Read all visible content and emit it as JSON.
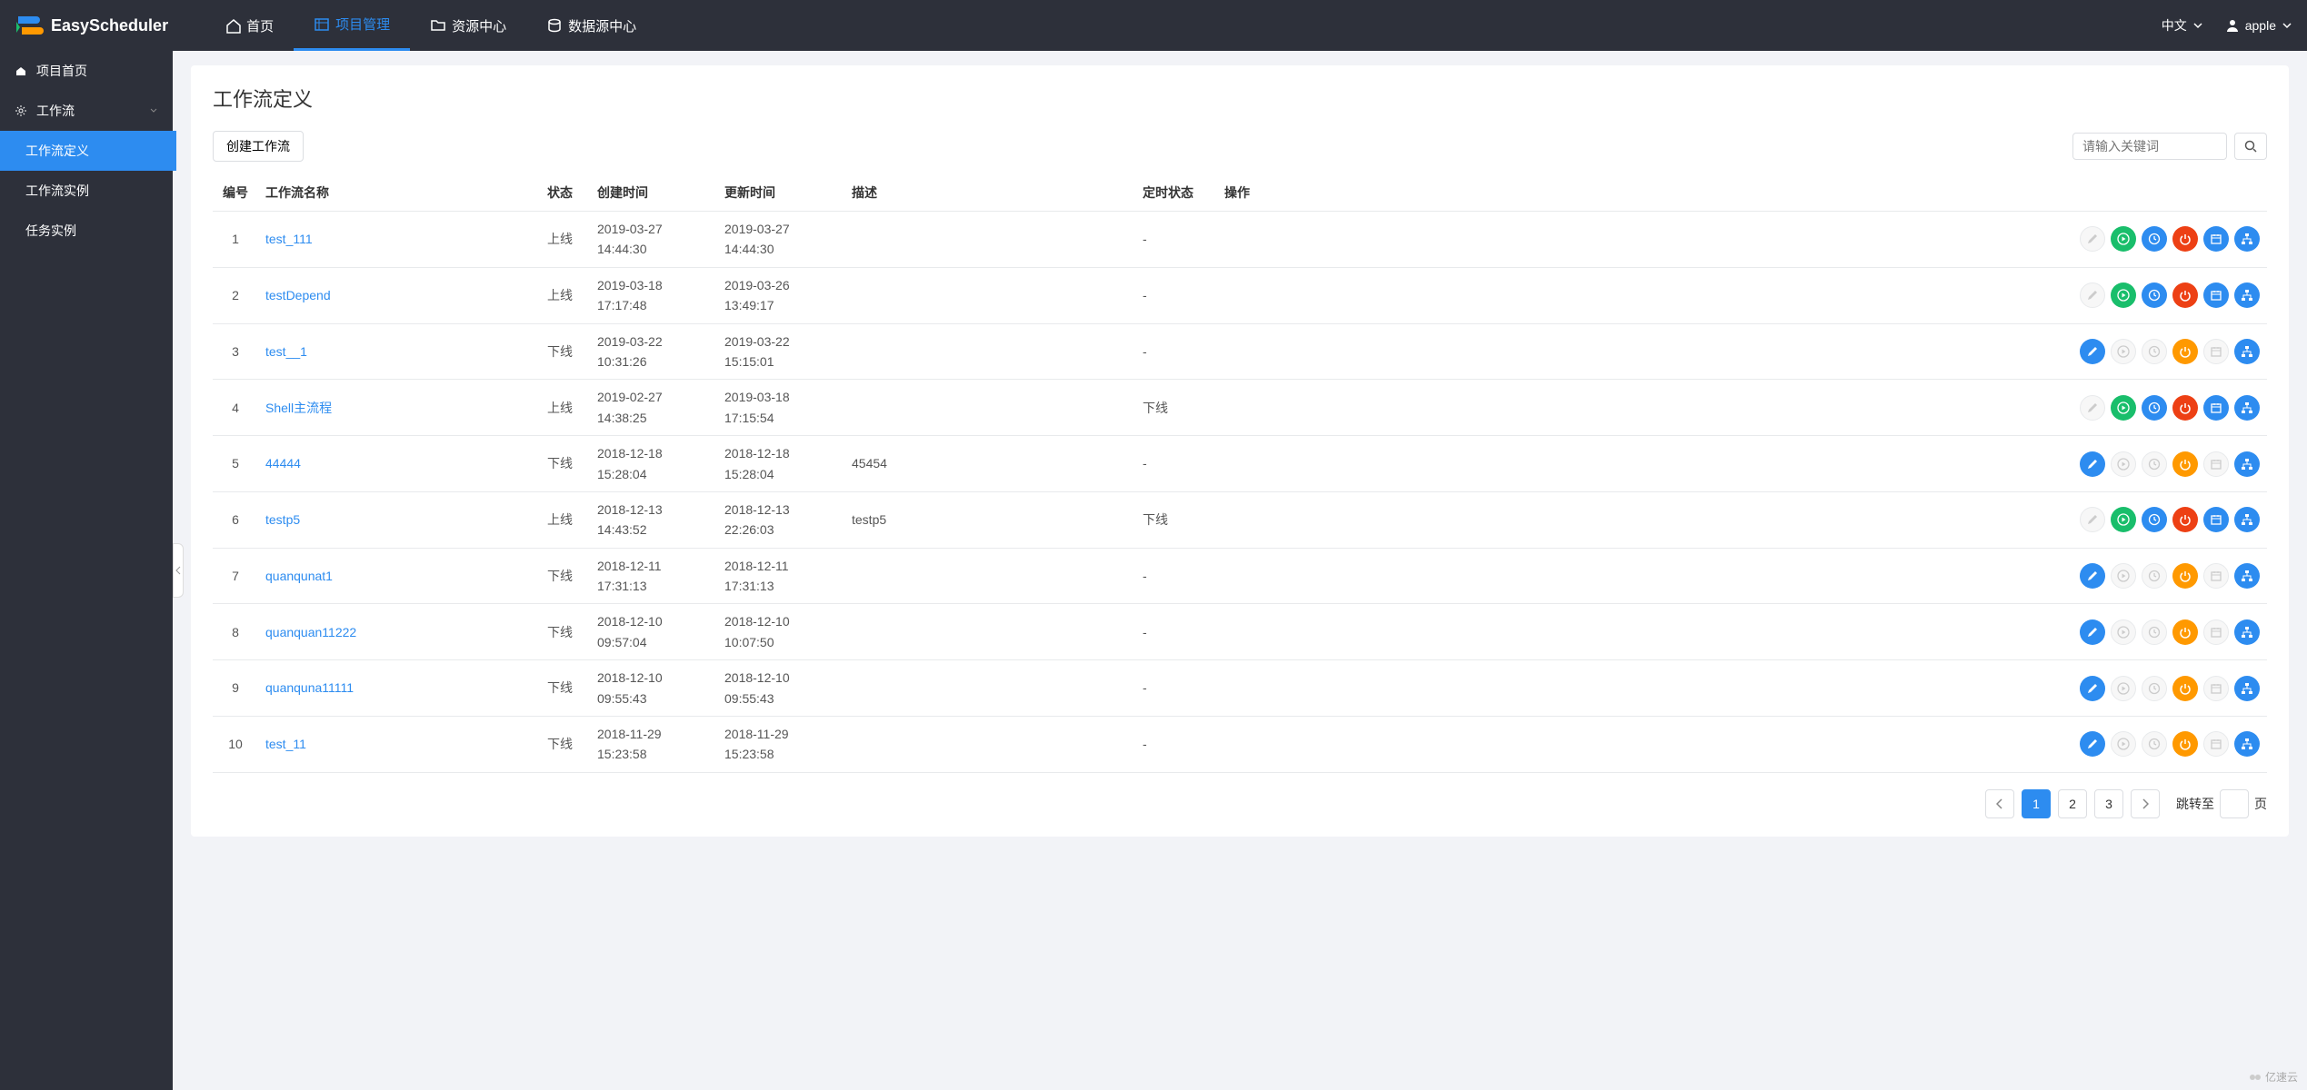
{
  "brand": "EasyScheduler",
  "nav": {
    "items": [
      {
        "label": "首页",
        "active": false
      },
      {
        "label": "项目管理",
        "active": true
      },
      {
        "label": "资源中心",
        "active": false
      },
      {
        "label": "数据源中心",
        "active": false
      }
    ],
    "lang": "中文",
    "user": "apple"
  },
  "sidebar": {
    "items": [
      {
        "label": "项目首页",
        "icon": "home",
        "active": false
      },
      {
        "label": "工作流",
        "icon": "gear",
        "active": false,
        "expandable": true
      },
      {
        "label": "工作流定义",
        "sub": true,
        "active": true
      },
      {
        "label": "工作流实例",
        "sub": true,
        "active": false
      },
      {
        "label": "任务实例",
        "sub": true,
        "active": false
      }
    ]
  },
  "page": {
    "title": "工作流定义",
    "create_btn": "创建工作流",
    "search_placeholder": "请输入关键词"
  },
  "columns": {
    "idx": "编号",
    "name": "工作流名称",
    "state": "状态",
    "created": "创建时间",
    "updated": "更新时间",
    "desc": "描述",
    "timer": "定时状态",
    "ops": "操作"
  },
  "rows": [
    {
      "idx": 1,
      "name": "test_111",
      "state": "上线",
      "created": "2019-03-27 14:44:30",
      "updated": "2019-03-27 14:44:30",
      "desc": "",
      "timer": "-",
      "mode": "online"
    },
    {
      "idx": 2,
      "name": "testDepend",
      "state": "上线",
      "created": "2019-03-18 17:17:48",
      "updated": "2019-03-26 13:49:17",
      "desc": "",
      "timer": "-",
      "mode": "online"
    },
    {
      "idx": 3,
      "name": "test__1",
      "state": "下线",
      "created": "2019-03-22 10:31:26",
      "updated": "2019-03-22 15:15:01",
      "desc": "",
      "timer": "-",
      "mode": "offline"
    },
    {
      "idx": 4,
      "name": "Shell主流程",
      "state": "上线",
      "created": "2019-02-27 14:38:25",
      "updated": "2019-03-18 17:15:54",
      "desc": "",
      "timer": "下线",
      "mode": "online"
    },
    {
      "idx": 5,
      "name": "44444",
      "state": "下线",
      "created": "2018-12-18 15:28:04",
      "updated": "2018-12-18 15:28:04",
      "desc": "45454",
      "timer": "-",
      "mode": "offline"
    },
    {
      "idx": 6,
      "name": "testp5",
      "state": "上线",
      "created": "2018-12-13 14:43:52",
      "updated": "2018-12-13 22:26:03",
      "desc": "testp5",
      "timer": "下线",
      "mode": "online"
    },
    {
      "idx": 7,
      "name": "quanqunat1",
      "state": "下线",
      "created": "2018-12-11 17:31:13",
      "updated": "2018-12-11 17:31:13",
      "desc": "",
      "timer": "-",
      "mode": "offline"
    },
    {
      "idx": 8,
      "name": "quanquan11222",
      "state": "下线",
      "created": "2018-12-10 09:57:04",
      "updated": "2018-12-10 10:07:50",
      "desc": "",
      "timer": "-",
      "mode": "offline"
    },
    {
      "idx": 9,
      "name": "quanquna11111",
      "state": "下线",
      "created": "2018-12-10 09:55:43",
      "updated": "2018-12-10 09:55:43",
      "desc": "",
      "timer": "-",
      "mode": "offline"
    },
    {
      "idx": 10,
      "name": "test_11",
      "state": "下线",
      "created": "2018-11-29 15:23:58",
      "updated": "2018-11-29 15:23:58",
      "desc": "",
      "timer": "-",
      "mode": "offline"
    }
  ],
  "pagination": {
    "pages": [
      "1",
      "2",
      "3"
    ],
    "active": 1,
    "jump_label": "跳转至",
    "jump_suffix": "页"
  },
  "watermark": "亿速云"
}
